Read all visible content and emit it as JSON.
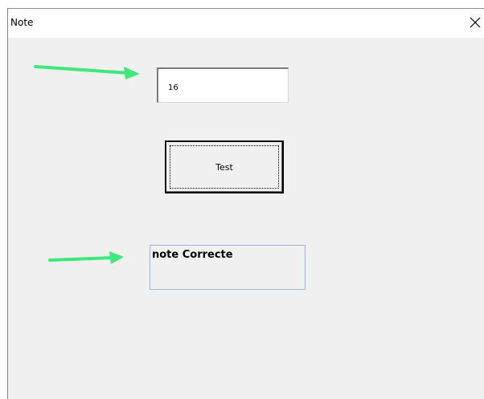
{
  "window": {
    "title": "Note",
    "close_icon": "close-icon"
  },
  "form": {
    "note_value": "16",
    "test_button_label": "Test",
    "result_label": "note Correcte"
  },
  "annotations": {
    "arrow_icon": "green-arrow-icon",
    "arrow_color": "#3ee87a"
  },
  "colors": {
    "form_background": "#f0f0f0",
    "label_border": "#9fb4d0"
  }
}
